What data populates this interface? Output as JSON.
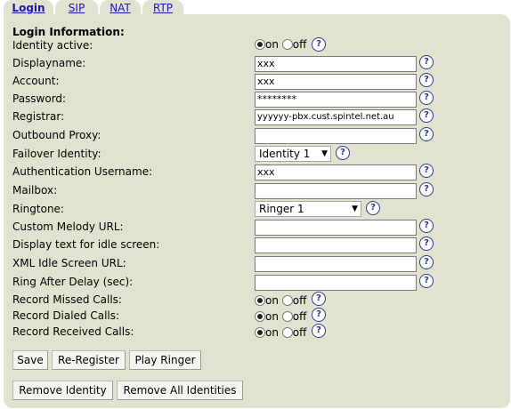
{
  "tabs": [
    {
      "label": "Login"
    },
    {
      "label": "SIP"
    },
    {
      "label": "NAT"
    },
    {
      "label": "RTP"
    }
  ],
  "section_title": "Login Information:",
  "help_symbol": "?",
  "radio_on": "on",
  "radio_off": "off",
  "fields": {
    "identity_active": {
      "label": "Identity active:"
    },
    "displayname": {
      "label": "Displayname:",
      "value": "xxx"
    },
    "account": {
      "label": "Account:",
      "value": "xxx"
    },
    "password": {
      "label": "Password:",
      "value": "********"
    },
    "registrar": {
      "label": "Registrar:",
      "value": "yyyyyy-pbx.cust.spintel.net.au"
    },
    "outbound_proxy": {
      "label": "Outbound Proxy:",
      "value": ""
    },
    "failover_identity": {
      "label": "Failover Identity:",
      "value": "Identity 1"
    },
    "auth_username": {
      "label": "Authentication Username:",
      "value": "xxx"
    },
    "mailbox": {
      "label": "Mailbox:",
      "value": ""
    },
    "ringtone": {
      "label": "Ringtone:",
      "value": "Ringer 1"
    },
    "custom_melody_url": {
      "label": "Custom Melody URL:",
      "value": ""
    },
    "idle_display_text": {
      "label": "Display text for idle screen:",
      "value": ""
    },
    "xml_idle_screen_url": {
      "label": "XML Idle Screen URL:",
      "value": ""
    },
    "ring_after_delay": {
      "label": "Ring After Delay (sec):",
      "value": ""
    },
    "record_missed_calls": {
      "label": "Record Missed Calls:"
    },
    "record_dialed_calls": {
      "label": "Record Dialed Calls:"
    },
    "record_received_calls": {
      "label": "Record Received Calls:"
    }
  },
  "buttons": {
    "save": "Save",
    "reregister": "Re-Register",
    "play_ringer": "Play Ringer",
    "remove_identity": "Remove Identity",
    "remove_all_identities": "Remove All Identities"
  },
  "colors": {
    "panel_bg": "#e1e3d0",
    "link": "#1a1aa0",
    "help_icon": "#2b3d8f"
  }
}
